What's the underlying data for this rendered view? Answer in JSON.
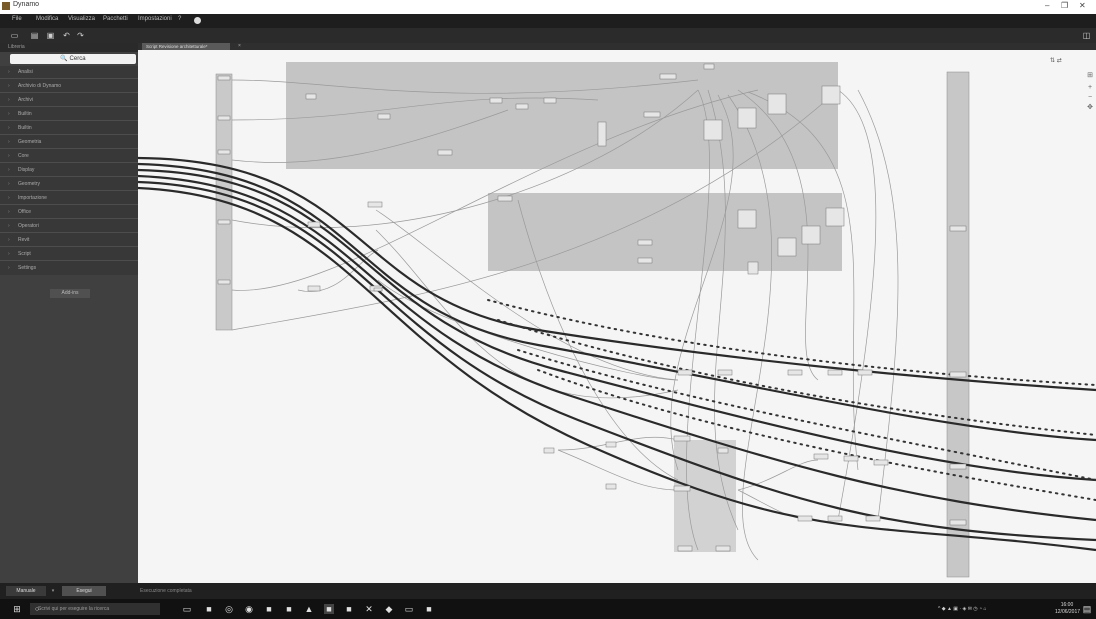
{
  "window": {
    "title": "Dynamo",
    "minimize": "–",
    "maximize": "❐",
    "close": "✕"
  },
  "menu": [
    "File",
    "Modifica",
    "Visualizza",
    "Pacchetti",
    "Impostazioni",
    "?"
  ],
  "toolbar_icons": [
    "new-file-icon",
    "open-file-icon",
    "save-icon",
    "undo-icon",
    "redo-icon"
  ],
  "sidebar": {
    "header": "Libreria",
    "search_label": "🔍 Cerca",
    "categories": [
      "Analisi",
      "Archivio di Dynamo",
      "Archivi",
      "Builtin",
      "Builtin",
      "Geometria",
      "Core",
      "Display",
      "Geometry",
      "Importazione",
      "Office",
      "Operatori",
      "Revit",
      "Script",
      "Settings"
    ],
    "advanced_button": "Add-ins"
  },
  "workspace_tab": "Script Revisione architetturale*",
  "bottom": {
    "run_mode": "Manuale",
    "run_button": "Esegui",
    "status": "Esecuzione completata"
  },
  "taskbar": {
    "search_placeholder": "Scrivi qui per eseguire la ricerca",
    "time": "16:00",
    "date": "12/06/2017"
  }
}
